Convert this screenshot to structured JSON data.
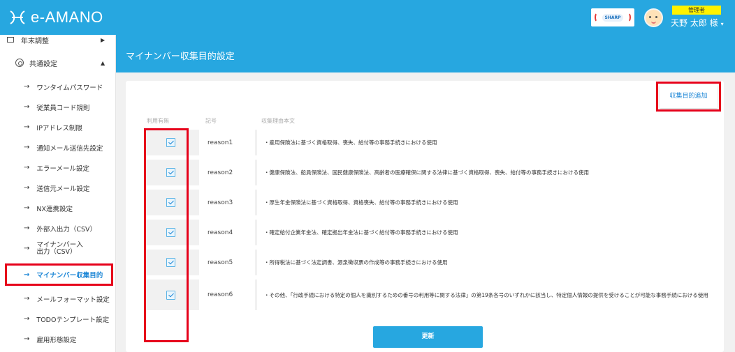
{
  "app": {
    "logo_text": "e-AMANO",
    "badge_text": "SHARP"
  },
  "user": {
    "role": "管理者",
    "name": "天野 太郎 様",
    "caret": "▾"
  },
  "sidebar": {
    "top_item": "年末調整",
    "common_settings": "共通設定",
    "items": [
      {
        "label": "ワンタイムパスワード"
      },
      {
        "label": "従業員コード規則"
      },
      {
        "label": "IPアドレス制限"
      },
      {
        "label": "通知メール送信先設定"
      },
      {
        "label": "エラーメール設定"
      },
      {
        "label": "送信元メール設定"
      },
      {
        "label": "NX連携設定"
      },
      {
        "label": "外部入出力（CSV）"
      },
      {
        "label": "マイナンバー入出力（CSV）"
      },
      {
        "label": "マイナンバー収集目的"
      },
      {
        "label": "メールフォーマット設定"
      },
      {
        "label": "TODOテンプレート設定"
      },
      {
        "label": "雇用形態設定"
      }
    ]
  },
  "page": {
    "title": "マイナンバー収集目的設定"
  },
  "toolbar": {
    "add_label": "収集目的追加",
    "update_label": "更新"
  },
  "table": {
    "headers": {
      "use": "利用有無",
      "code": "記号",
      "reason": "収集理由本文"
    },
    "rows": [
      {
        "checked": true,
        "code": "reason1",
        "text": "・雇用保険法に基づく資格取得、喪失、給付等の事務手続きにおける使用"
      },
      {
        "checked": true,
        "code": "reason2",
        "text": "・健康保険法、船員保険法、国民健康保険法、高齢者の医療確保に関する法律に基づく資格取得、喪失、給付等の事務手続きにおける使用"
      },
      {
        "checked": true,
        "code": "reason3",
        "text": "・厚生年金保険法に基づく資格取得、資格喪失、給付等の事務手続きにおける使用"
      },
      {
        "checked": true,
        "code": "reason4",
        "text": "・確定給付企業年金法、確定拠出年金法に基づく給付等の事務手続きにおける使用"
      },
      {
        "checked": true,
        "code": "reason5",
        "text": "・所得税法に基づく法定調書、源泉徴収票の作成等の事務手続きにおける使用"
      },
      {
        "checked": true,
        "code": "reason6",
        "text": "・その他、「行政手続における特定の個人を識別するための番号の利用等に関する法律」の第19条各号のいずれかに該当し、特定個人情報の提供を受けることが可能な事務手続における使用"
      }
    ]
  },
  "colors": {
    "header_blue": "#27a7e0",
    "highlight_red": "#e6001a",
    "link_blue": "#1c86d6"
  }
}
